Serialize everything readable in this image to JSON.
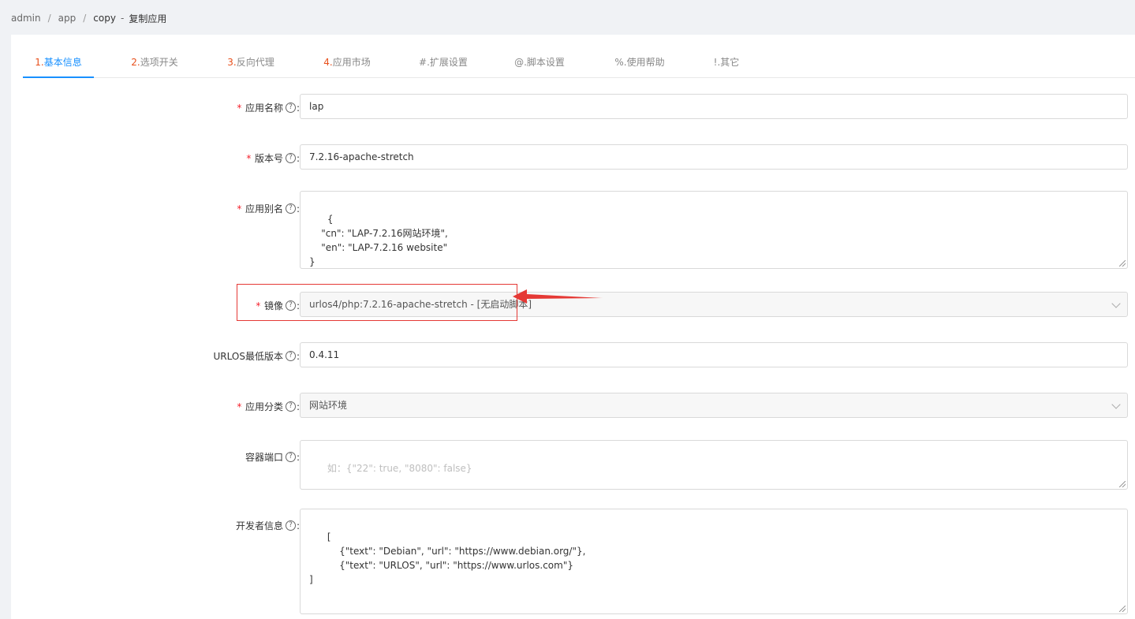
{
  "breadcrumb": {
    "items": [
      "admin",
      "app",
      "copy"
    ],
    "dash": "-",
    "title": "复制应用"
  },
  "tabs": [
    {
      "num": "1.",
      "label": "基本信息"
    },
    {
      "num": "2.",
      "label": "选项开关"
    },
    {
      "num": "3.",
      "label": "反向代理"
    },
    {
      "num": "4.",
      "label": "应用市场"
    },
    {
      "num": "#.",
      "label": "扩展设置"
    },
    {
      "num": "@.",
      "label": "脚本设置"
    },
    {
      "num": "%.",
      "label": "使用帮助"
    },
    {
      "num": "!.",
      "label": "其它"
    }
  ],
  "form": {
    "app_name": {
      "label": "应用名称",
      "value": "lap"
    },
    "version": {
      "label": "版本号",
      "value": "7.2.16-apache-stretch"
    },
    "alias": {
      "label": "应用别名",
      "value": "{\n    \"cn\": \"LAP-7.2.16网站环境\",\n    \"en\": \"LAP-7.2.16 website\"\n}"
    },
    "image": {
      "label": "镜像",
      "value": "urlos4/php:7.2.16-apache-stretch - [无启动脚本]"
    },
    "min_version": {
      "label": "URLOS最低版本",
      "value": "0.4.11"
    },
    "category": {
      "label": "应用分类",
      "value": "网站环境"
    },
    "ports": {
      "label": "容器端口",
      "placeholder": "如：{\"22\": true, \"8080\": false}"
    },
    "developer": {
      "label": "开发者信息",
      "value": "[\n          {\"text\": \"Debian\", \"url\": \"https://www.debian.org/\"},\n          {\"text\": \"URLOS\", \"url\": \"https://www.urlos.com\"}\n]"
    }
  },
  "symbols": {
    "required": "*",
    "help": "?",
    "colon": ":"
  },
  "colors": {
    "accent": "#1890ff",
    "tab_num": "#e8501c",
    "required": "#f5222d",
    "annotation": "#e53935"
  },
  "icons": [
    "help-circle-icon",
    "chevron-down-icon",
    "resize-grip-icon",
    "red-arrow-annotation"
  ]
}
